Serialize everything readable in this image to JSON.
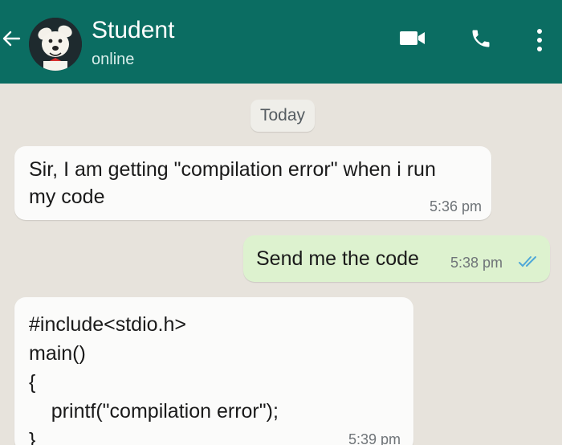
{
  "header": {
    "contact_name": "Student",
    "status": "online",
    "colors": {
      "bar": "#0b6d62",
      "text": "#ffffff"
    },
    "icons": [
      "back-arrow-icon",
      "video-call-icon",
      "phone-icon",
      "more-vertical-icon"
    ]
  },
  "chat": {
    "date_label": "Today",
    "messages": [
      {
        "direction": "incoming",
        "text": "Sir, I am getting \"compilation error\" when i run my code",
        "time": "5:36 pm"
      },
      {
        "direction": "outgoing",
        "text": "Send me the code",
        "time": "5:38 pm",
        "status": "read"
      },
      {
        "direction": "incoming",
        "code_lines": [
          "#include<stdio.h>",
          "main()",
          "{",
          "    printf(\"compilation error\");",
          "}"
        ],
        "time": "5:39 pm"
      }
    ]
  }
}
